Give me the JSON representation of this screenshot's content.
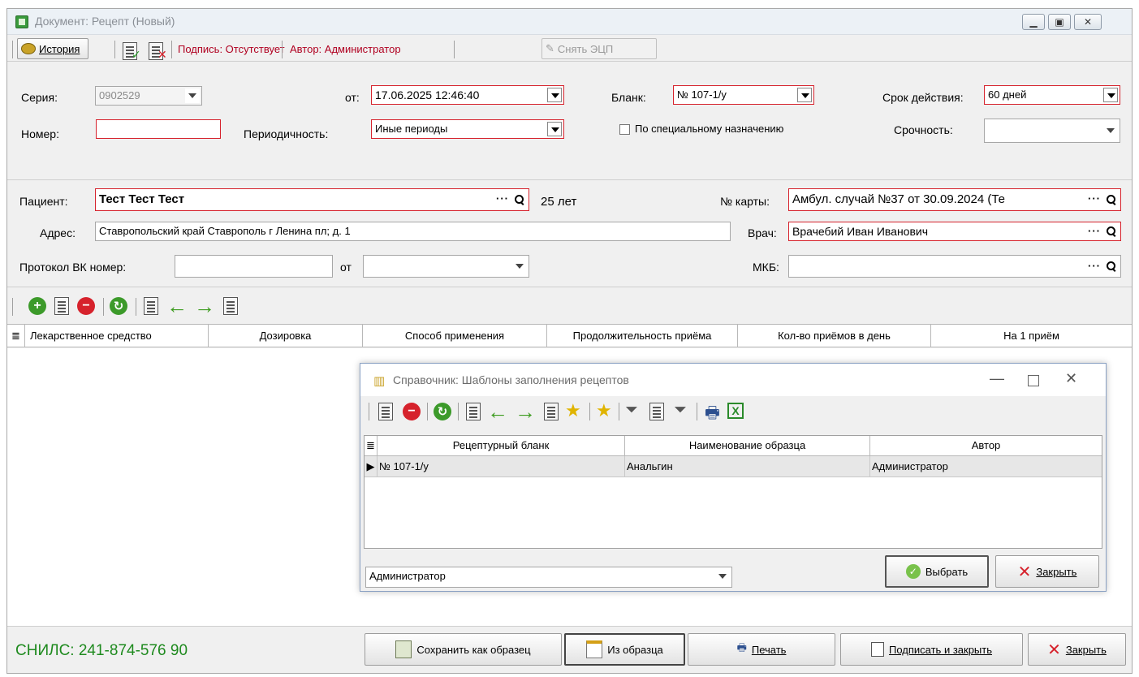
{
  "window": {
    "title": "Документ: Рецепт (Новый)",
    "controls": [
      "minimize",
      "restore",
      "close"
    ]
  },
  "toolbar": {
    "history_label": "История",
    "signature_label": "Подпись: Отсутствует",
    "author_label": "Автор: Администратор",
    "remove_sign_label": "Снять ЭЦП"
  },
  "form": {
    "series_label": "Серия:",
    "series_value": "0902529",
    "from_label": "от:",
    "from_value": "17.06.2025 12:46:40",
    "blank_label": "Бланк:",
    "blank_value": "№ 107-1/у",
    "validity_label": "Срок действия:",
    "validity_value": "60 дней",
    "number_label": "Номер:",
    "number_value": "",
    "periodicity_label": "Периодичность:",
    "periodicity_value": "Иные периоды",
    "special_label": "По специальному назначению",
    "urgency_label": "Срочность:",
    "urgency_value": ""
  },
  "patient": {
    "patient_label": "Пациент:",
    "patient_value": "Тест Тест Тест",
    "age": "25 лет",
    "card_label": "№ карты:",
    "card_value": "Амбул. случай №37 от 30.09.2024 (Те",
    "address_label": "Адрес:",
    "address_value": "Ставропольский край Ставрополь г Ленина пл; д. 1",
    "doctor_label": "Врач:",
    "doctor_value": "Врачебий Иван Иванович",
    "protocol_label": "Протокол ВК номер:",
    "protocol_value": "",
    "protocol_from_label": "от",
    "protocol_from_value": "",
    "mkb_label": "МКБ:",
    "mkb_value": ""
  },
  "grid": {
    "columns": [
      "Лекарственное средство",
      "Дозировка",
      "Способ применения",
      "Продолжительность приёма",
      "Кол-во приёмов в день",
      "На 1 приём"
    ]
  },
  "dialog": {
    "title": "Справочник: Шаблоны заполнения рецептов",
    "columns": [
      "Рецептурный бланк",
      "Наименование образца",
      "Автор"
    ],
    "rows": [
      {
        "blank": "№ 107-1/у",
        "name": "Анальгин",
        "author": "Администратор"
      }
    ],
    "filter_value": "Администратор",
    "select_label": "Выбрать",
    "close_label": "Закрыть"
  },
  "bottom": {
    "snils": "СНИЛС: 241-874-576 90",
    "save_template": "Сохранить как образец",
    "from_template": "Из образца",
    "print": "Печать",
    "sign_close": "Подписать и закрыть",
    "close": "Закрыть"
  }
}
